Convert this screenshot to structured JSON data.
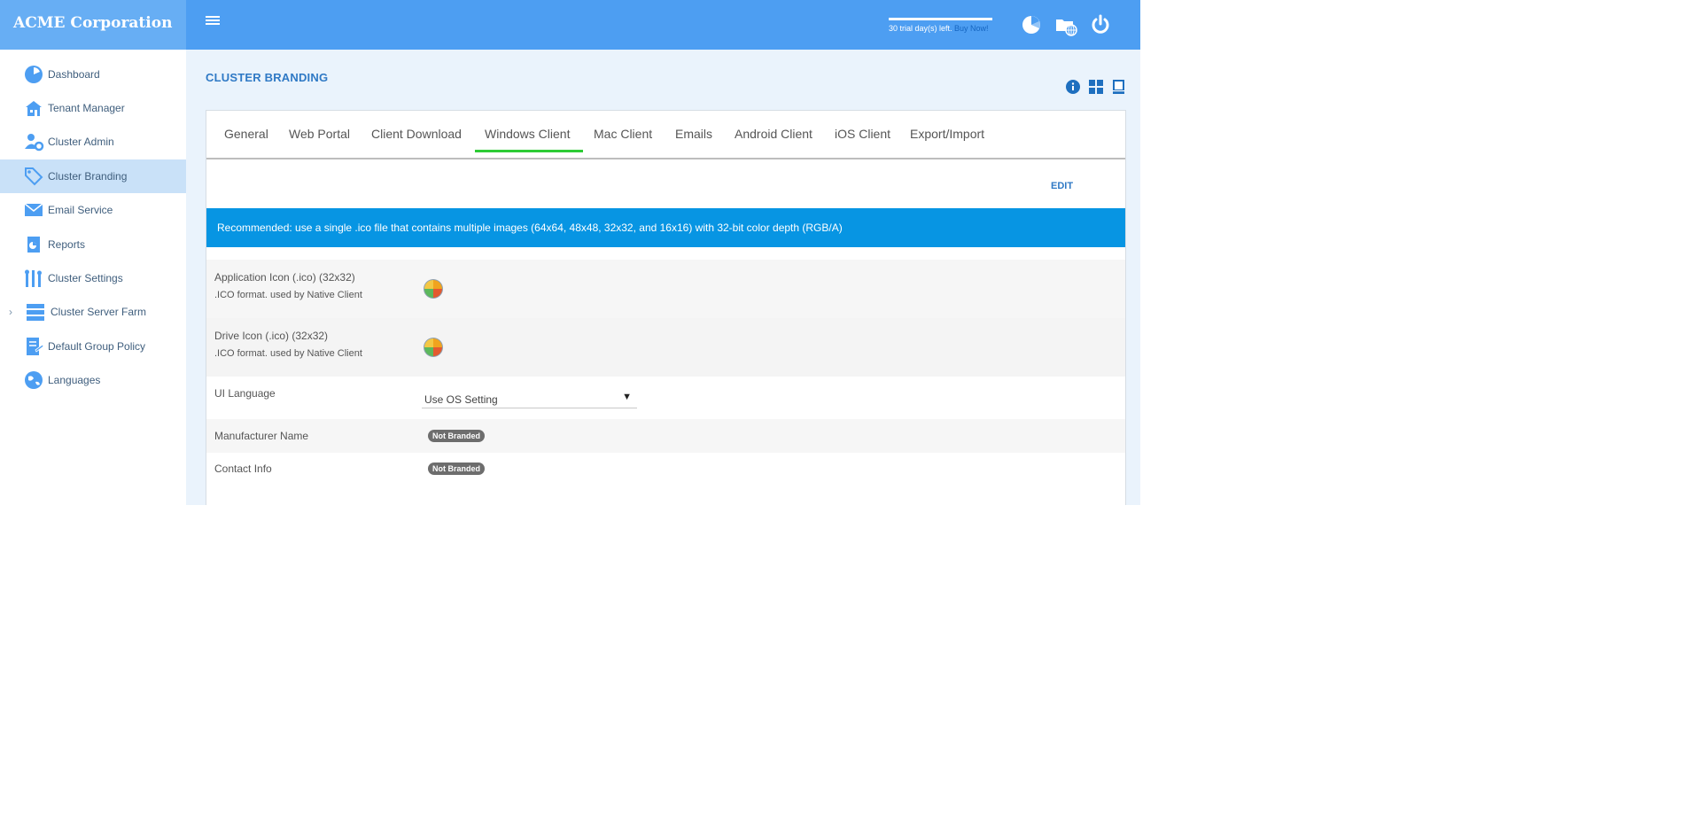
{
  "app": {
    "brand": "ACME Corporation"
  },
  "topbar": {
    "trial_text": "30 trial day(s) left.",
    "buy_now": "Buy Now!",
    "icons": [
      "dashboard-icon",
      "folder-globe-icon",
      "power-icon"
    ]
  },
  "sidebar": {
    "items": [
      {
        "label": "Dashboard",
        "icon": "dashboard-icon"
      },
      {
        "label": "Tenant Manager",
        "icon": "building-icon"
      },
      {
        "label": "Cluster Admin",
        "icon": "admin-gear-icon"
      },
      {
        "label": "Cluster Branding",
        "icon": "tag-icon",
        "active": true
      },
      {
        "label": "Email Service",
        "icon": "envelope-icon"
      },
      {
        "label": "Reports",
        "icon": "report-icon"
      },
      {
        "label": "Cluster Settings",
        "icon": "tools-icon"
      },
      {
        "label": "Cluster Server Farm",
        "icon": "server-icon",
        "expandable": true
      },
      {
        "label": "Default Group Policy",
        "icon": "policy-icon"
      },
      {
        "label": "Languages",
        "icon": "globe-icon"
      }
    ]
  },
  "main": {
    "title": "CLUSTER BRANDING",
    "header_icons": [
      "info-icon",
      "grid-icon",
      "book-icon"
    ],
    "tabs": [
      {
        "label": "General"
      },
      {
        "label": "Web Portal"
      },
      {
        "label": "Client Download"
      },
      {
        "label": "Windows Client",
        "active": true
      },
      {
        "label": "Mac Client"
      },
      {
        "label": "Emails"
      },
      {
        "label": "Android Client"
      },
      {
        "label": "iOS Client"
      },
      {
        "label": "Export/Import"
      }
    ],
    "edit_label": "EDIT",
    "recommendation": "Recommended: use a single .ico file that contains multiple images (64x64, 48x48, 32x32, and 16x16) with 32-bit color depth (RGB/A)",
    "fields": {
      "app_icon": {
        "label": "Application Icon (.ico) (32x32)",
        "sub": ".ICO format. used by Native Client"
      },
      "drive_icon": {
        "label": "Drive Icon (.ico) (32x32)",
        "sub": ".ICO format. used by Native Client"
      },
      "ui_language": {
        "label": "UI Language",
        "value": "Use OS Setting"
      },
      "manufacturer": {
        "label": "Manufacturer Name",
        "badge": "Not Branded"
      },
      "contact": {
        "label": "Contact Info",
        "badge": "Not Branded"
      }
    }
  },
  "colors": {
    "topbar": "#4d9ef2",
    "brand_bg": "#67aef4",
    "accent": "#2f79c5",
    "banner": "#0795e3",
    "tab_active_underline": "#2dcb35",
    "sidebar_active": "#c9e1f8"
  }
}
